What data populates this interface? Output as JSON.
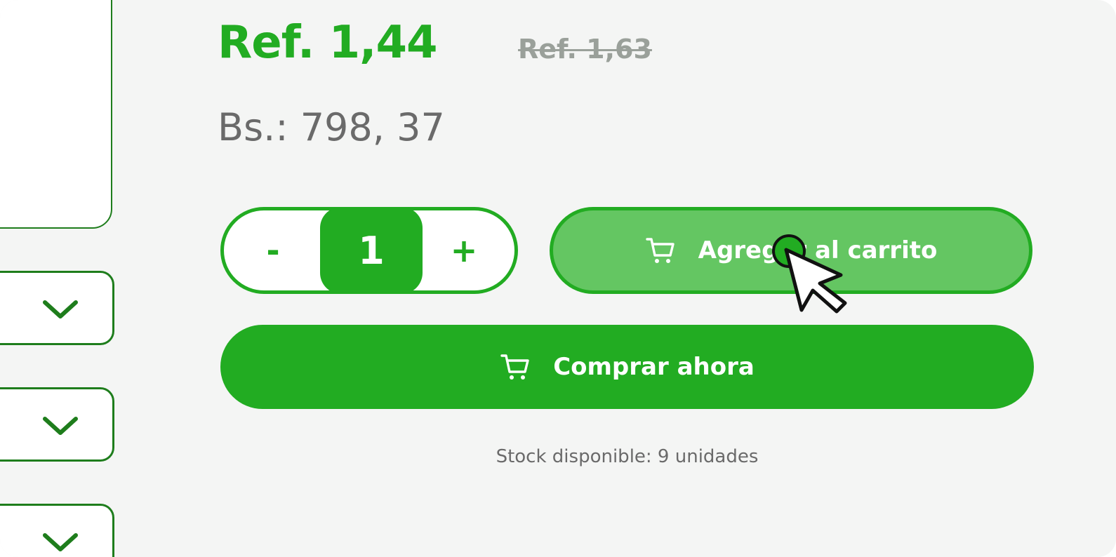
{
  "product": {
    "price_ref": "Ref. 1,44",
    "price_ref_old": "Ref. 1,63",
    "price_bs": "Bs.: 798, 37"
  },
  "quantity": {
    "minus_label": "-",
    "value": "1",
    "plus_label": "+"
  },
  "actions": {
    "add_to_cart_label": "Agregar al carrito",
    "buy_now_label": "Comprar ahora"
  },
  "stock_text": "Stock disponible: 9 unidades",
  "icons": {
    "cart": "cart-icon",
    "dropdown": "chevron-down-icon",
    "cursor": "mouse-pointer-icon"
  },
  "colors": {
    "primary_green": "#22ac22",
    "light_green": "#64c662",
    "dark_green_border": "#1e7d1c",
    "background": "#f4f5f4",
    "muted_text": "#6a6a6a"
  }
}
